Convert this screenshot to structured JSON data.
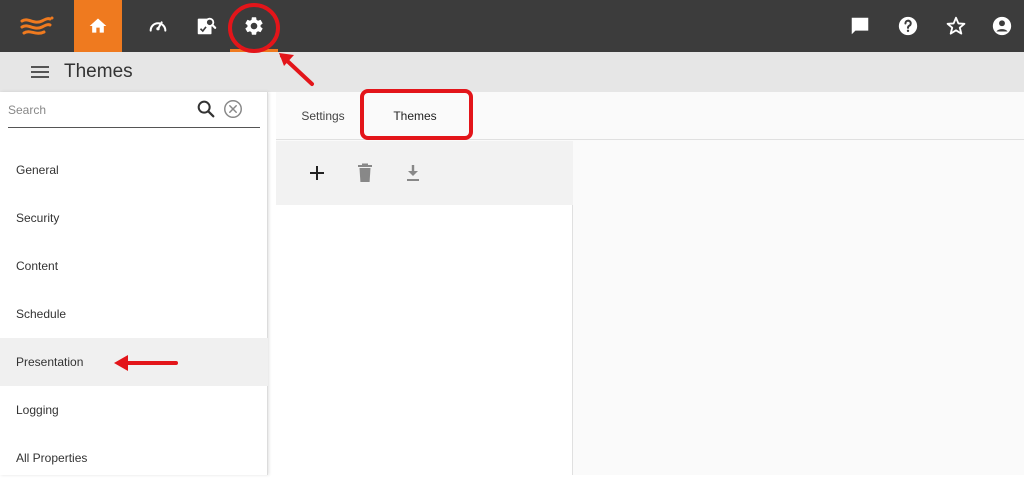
{
  "colors": {
    "topbar": "#3c3c3c",
    "accent": "#ef7a1f",
    "annotation": "#e3151a"
  },
  "topbar": {
    "icons": [
      "logo-icon",
      "home-icon",
      "dashboard-icon",
      "report-icon",
      "gear-icon",
      "chat-icon",
      "help-icon",
      "star-icon",
      "account-icon"
    ]
  },
  "header": {
    "title": "Themes"
  },
  "sidebar": {
    "search_placeholder": "Search",
    "items": [
      {
        "label": "General"
      },
      {
        "label": "Security"
      },
      {
        "label": "Content"
      },
      {
        "label": "Schedule"
      },
      {
        "label": "Presentation"
      },
      {
        "label": "Logging"
      },
      {
        "label": "All Properties"
      }
    ],
    "active_item": "Presentation"
  },
  "main": {
    "tabs": [
      {
        "label": "Settings"
      },
      {
        "label": "Themes"
      }
    ],
    "active_tab": "Themes",
    "toolbar": [
      "add-icon",
      "delete-icon",
      "download-icon"
    ]
  }
}
